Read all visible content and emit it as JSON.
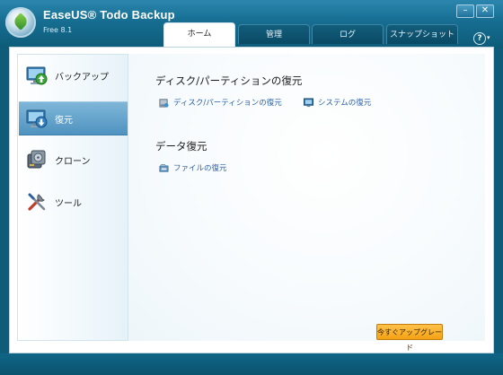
{
  "app": {
    "title": "EaseUS® Todo Backup",
    "version": "Free 8.1"
  },
  "window_controls": {
    "minimize": "–",
    "close": "✕"
  },
  "tabs": [
    {
      "label": "ホーム",
      "active": true
    },
    {
      "label": "管理",
      "active": false
    },
    {
      "label": "ログ",
      "active": false
    },
    {
      "label": "スナップショット",
      "active": false
    }
  ],
  "help": {
    "label": "?",
    "caret": "▾"
  },
  "sidebar": {
    "items": [
      {
        "label": "バックアップ",
        "icon": "backup-monitor-icon",
        "selected": false
      },
      {
        "label": "復元",
        "icon": "restore-monitor-icon",
        "selected": true
      },
      {
        "label": "クローン",
        "icon": "clone-disk-icon",
        "selected": false
      },
      {
        "label": "ツール",
        "icon": "tools-icon",
        "selected": false
      }
    ]
  },
  "main": {
    "disk_section": {
      "title": "ディスク/パーティションの復元",
      "links": [
        {
          "label": "ディスク/パーティションの復元",
          "icon": "disk-restore-icon"
        },
        {
          "label": "システムの復元",
          "icon": "system-restore-icon"
        }
      ]
    },
    "data_section": {
      "title": "データ復元",
      "links": [
        {
          "label": "ファイルの復元",
          "icon": "file-restore-icon"
        }
      ]
    },
    "upgrade_button": "今すぐアップグレード"
  },
  "colors": {
    "header": "#166e92",
    "selected_nav": "#4f93c0",
    "link": "#2a5fa8",
    "upgrade": "#f3a214"
  }
}
